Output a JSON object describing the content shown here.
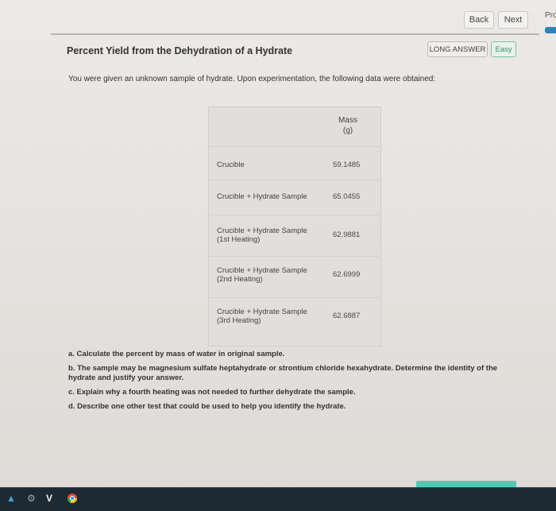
{
  "nav": {
    "back": "Back",
    "next": "Next",
    "cut_label": "Pro"
  },
  "title": "Percent Yield from the Dehydration of a Hydrate",
  "badges": {
    "type": "LONG ANSWER",
    "difficulty": "Easy"
  },
  "intro": "You were given an unknown sample of hydrate. Upon experimentation, the following data were obtained:",
  "table": {
    "header_line1": "Mass",
    "header_line2": "(g)",
    "rows": [
      {
        "label_1": "Crucible",
        "label_2": "",
        "value": "59.1485"
      },
      {
        "label_1": "Crucible + Hydrate Sample",
        "label_2": "",
        "value": "65.0455"
      },
      {
        "label_1": "Crucible + Hydrate Sample",
        "label_2": "(1st Heating)",
        "value": "62.9881"
      },
      {
        "label_1": "Crucible + Hydrate Sample",
        "label_2": "(2nd Heating)",
        "value": "62.6999"
      },
      {
        "label_1": "Crucible + Hydrate Sample",
        "label_2": "(3rd Heating)",
        "value": "62.6887"
      }
    ]
  },
  "questions": [
    "a. Calculate the percent by mass of water in original sample.",
    "b. The sample may be magnesium sulfate heptahydrate or strontium chloride hexahydrate. Determine the identity of the hydrate and justify your answer.",
    "c. Explain why a fourth heating was not needed to further dehydrate the sample.",
    "d. Describe one other test that could be used to help you identify the hydrate."
  ],
  "taskbar": {
    "icons": [
      "app-icon",
      "gear-icon",
      "v-logo-icon",
      "chrome-icon"
    ],
    "colors": {
      "background": "#1e2a33"
    }
  }
}
